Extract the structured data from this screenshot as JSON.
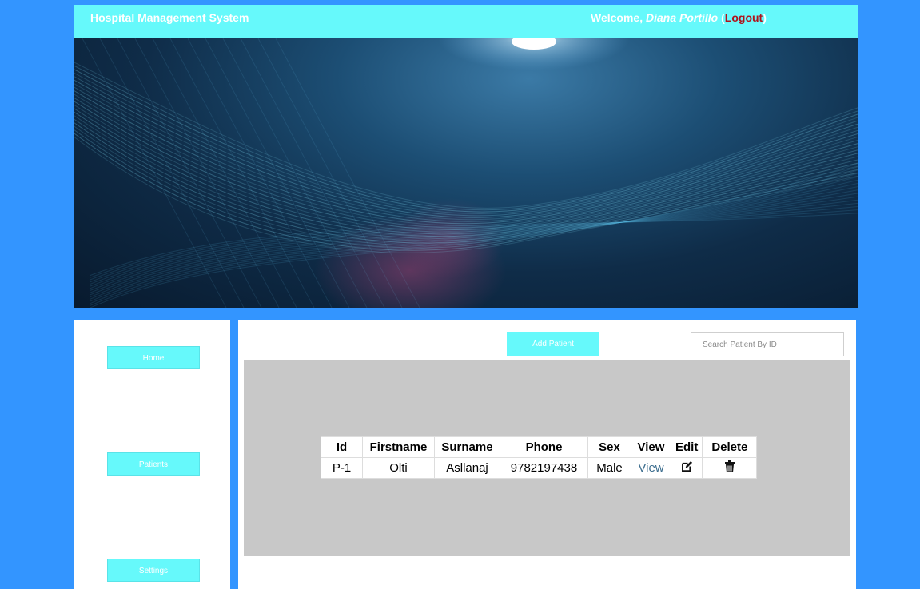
{
  "header": {
    "app_title": "Hospital Management System",
    "welcome_prefix": "Welcome, ",
    "user_name": "Diana Portillo",
    "logout_open": "(",
    "logout_label": "Logout",
    "logout_close": ")"
  },
  "sidebar": {
    "items": [
      {
        "label": "Home"
      },
      {
        "label": "Patients"
      },
      {
        "label": "Settings"
      }
    ]
  },
  "toolbar": {
    "add_label": "Add Patient",
    "search_placeholder": "Search Patient By ID"
  },
  "table": {
    "columns": [
      "Id",
      "Firstname",
      "Surname",
      "Phone",
      "Sex",
      "View",
      "Edit",
      "Delete"
    ],
    "rows": [
      {
        "id": "P-1",
        "firstname": "Olti",
        "surname": "Asllanaj",
        "phone": "9782197438",
        "sex": "Male",
        "view": "View",
        "edit_icon": "edit-icon",
        "delete_icon": "trash-icon"
      }
    ]
  },
  "colors": {
    "background": "#3395ff",
    "accent": "#66f9fb",
    "logout": "#b0121b",
    "content_grey": "#c8c8c8"
  }
}
